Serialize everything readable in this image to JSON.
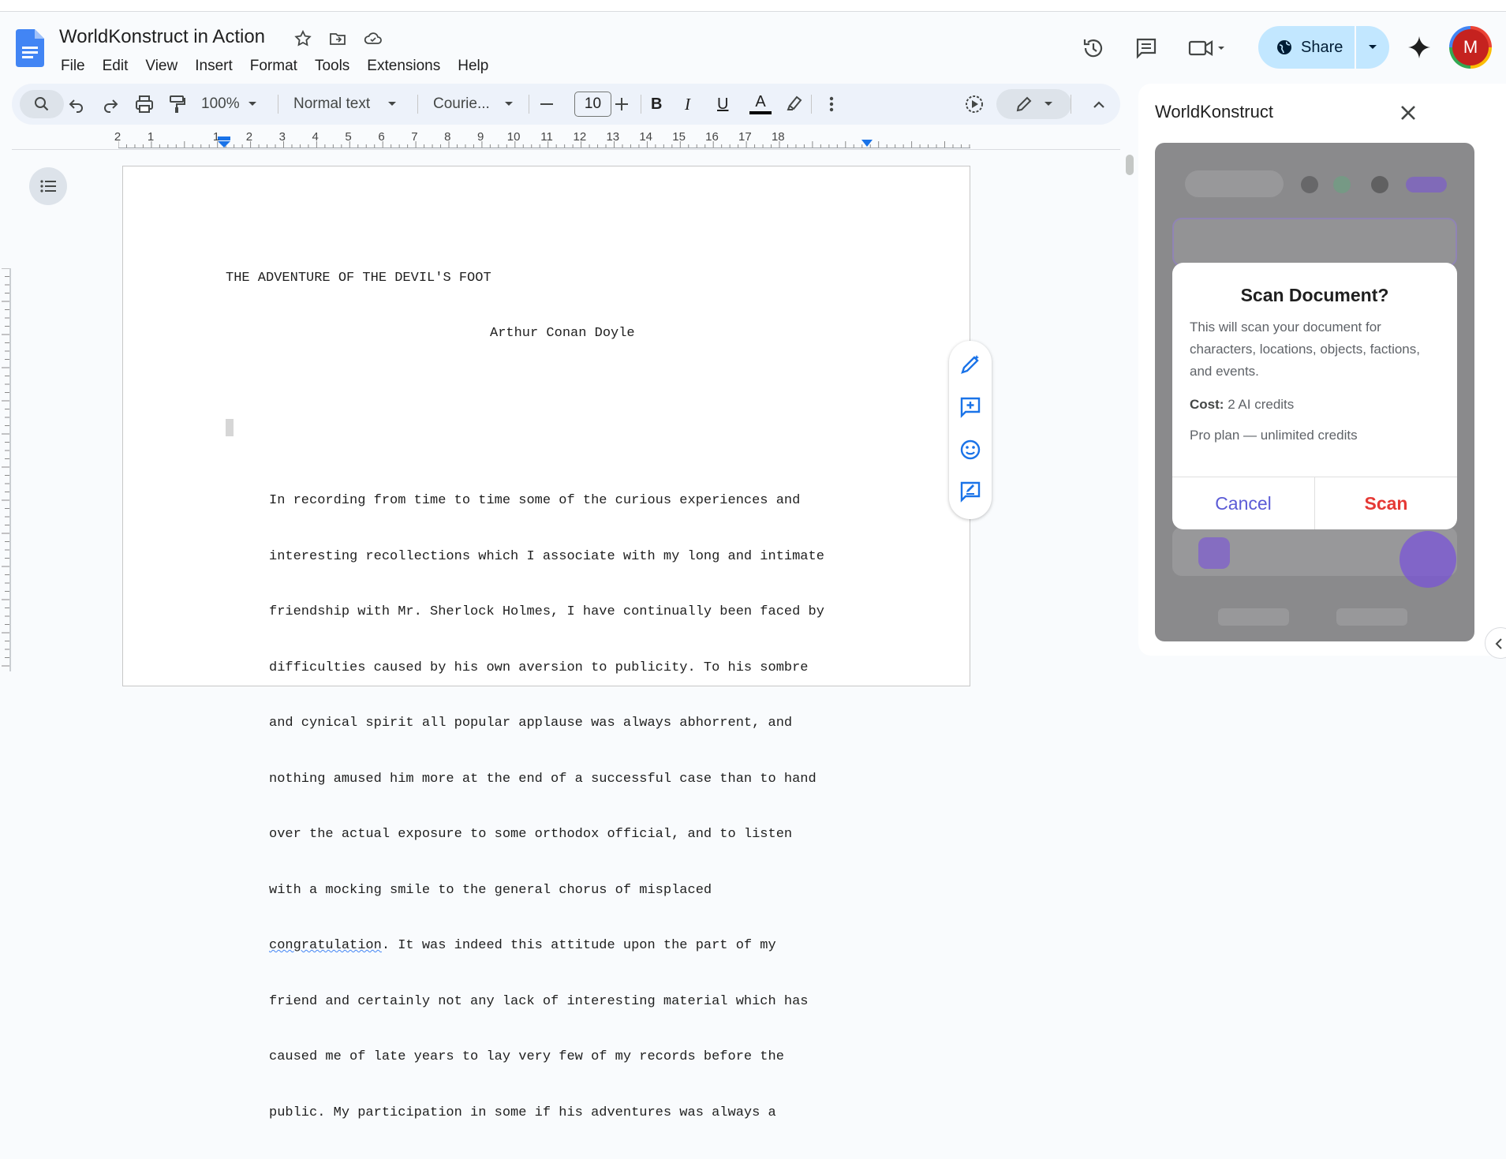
{
  "app": {
    "doc_title": "WorldKonstruct in Action"
  },
  "menu": [
    "File",
    "Edit",
    "View",
    "Insert",
    "Format",
    "Tools",
    "Extensions",
    "Help"
  ],
  "header": {
    "share_label": "Share",
    "avatar_initial": "M"
  },
  "toolbar": {
    "zoom": "100%",
    "style": "Normal text",
    "font": "Courie...",
    "font_size": "10"
  },
  "ruler": {
    "labels": [
      "2",
      "1",
      "1",
      "2",
      "3",
      "4",
      "5",
      "6",
      "7",
      "8",
      "9",
      "10",
      "11",
      "12",
      "13",
      "14",
      "15",
      "16",
      "17",
      "18"
    ]
  },
  "document": {
    "title": "THE ADVENTURE OF THE DEVIL'S FOOT",
    "author": "Arthur Conan Doyle",
    "body_lines": [
      "In recording from time to time some of the curious experiences and",
      "interesting recollections which I associate with my long and intimate",
      "friendship with Mr. Sherlock Holmes, I have continually been faced by",
      "difficulties caused by his own aversion to publicity. To his sombre",
      "and cynical spirit all popular applause was always abhorrent, and",
      "nothing amused him more at the end of a successful case than to hand",
      "over the actual exposure to some orthodox official, and to listen",
      "with a mocking smile to the general chorus of misplaced",
      "congratulation. It was indeed this attitude upon the part of my",
      "friend and certainly not any lack of interesting material which has",
      "caused me of late years to lay very few of my records before the",
      "public. My participation in some if his adventures was always a"
    ],
    "misspelled_word": "congratulation"
  },
  "side_panel": {
    "title": "WorldKonstruct",
    "modal": {
      "title": "Scan Document?",
      "description": "This will scan your document for characters, locations, objects, factions, and events.",
      "cost_label": "Cost:",
      "cost_value": "2 AI credits",
      "plan_note": "Pro plan — unlimited credits",
      "cancel_label": "Cancel",
      "scan_label": "Scan"
    }
  },
  "colors": {
    "accent_blue": "#0b57d0",
    "share_bg": "#c2e7ff",
    "cancel_color": "#5b5bd6",
    "scan_color": "#e53935"
  }
}
